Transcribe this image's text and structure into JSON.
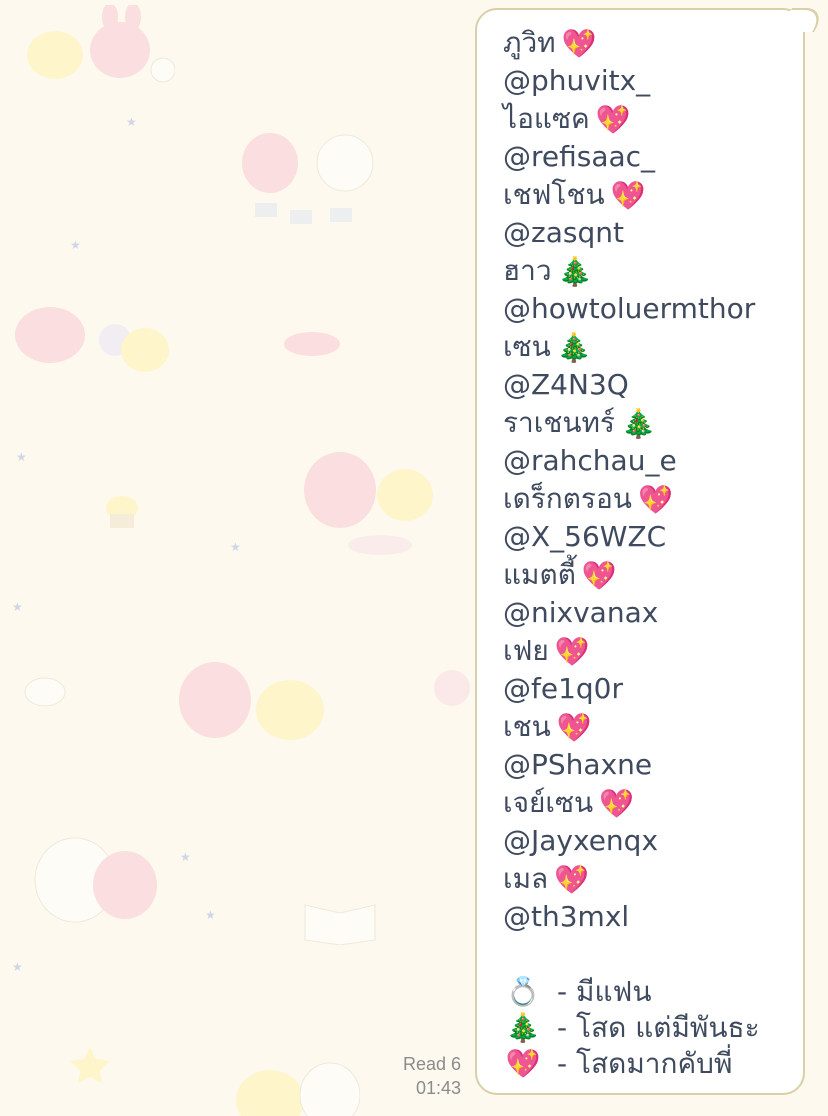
{
  "message": {
    "lines": [
      {
        "text": "ภูวิท",
        "emoji": "💖"
      },
      {
        "text": "@phuvitx_"
      },
      {
        "text": "ไอแซค",
        "emoji": "💖"
      },
      {
        "text": "@refisaac_"
      },
      {
        "text": "เชฟโชน",
        "emoji": "💖"
      },
      {
        "text": "@zasqnt"
      },
      {
        "text": "ฮาว",
        "emoji": "🎄"
      },
      {
        "text": "@howtoluermthor"
      },
      {
        "text": "เซน",
        "emoji": "🎄"
      },
      {
        "text": "@Z4N3Q"
      },
      {
        "text": "ราเชนทร์",
        "emoji": "🎄"
      },
      {
        "text": "@rahchau_e"
      },
      {
        "text": "เดร็กตรอน",
        "emoji": "💖"
      },
      {
        "text": "@X_56WZC"
      },
      {
        "text": "แมตตี้",
        "emoji": "💖"
      },
      {
        "text": "@nixvanax"
      },
      {
        "text": "เฟย",
        "emoji": "💖"
      },
      {
        "text": "@fe1q0r"
      },
      {
        "text": "เชน",
        "emoji": "💖"
      },
      {
        "text": "@PShaxne"
      },
      {
        "text": "เจย์เซน",
        "emoji": "💖"
      },
      {
        "text": "@Jayxenqx"
      },
      {
        "text": "เมล",
        "emoji": "💖"
      },
      {
        "text": "@th3mxl"
      }
    ],
    "legend": [
      {
        "emoji": "💍",
        "text": "- มีแฟน"
      },
      {
        "emoji": "🎄",
        "text": "- โสด แต่มีพันธะ"
      },
      {
        "emoji": "💖",
        "text": "- โสดมากคับพี่"
      }
    ]
  },
  "status": {
    "read": "Read 6",
    "time": "01:43"
  },
  "colors": {
    "background": "#fdf9ee",
    "bubble": "#ffffff",
    "bubble_border": "#d9cfa8",
    "text": "#3f4a5f",
    "meta_text": "#8b8b8b"
  }
}
